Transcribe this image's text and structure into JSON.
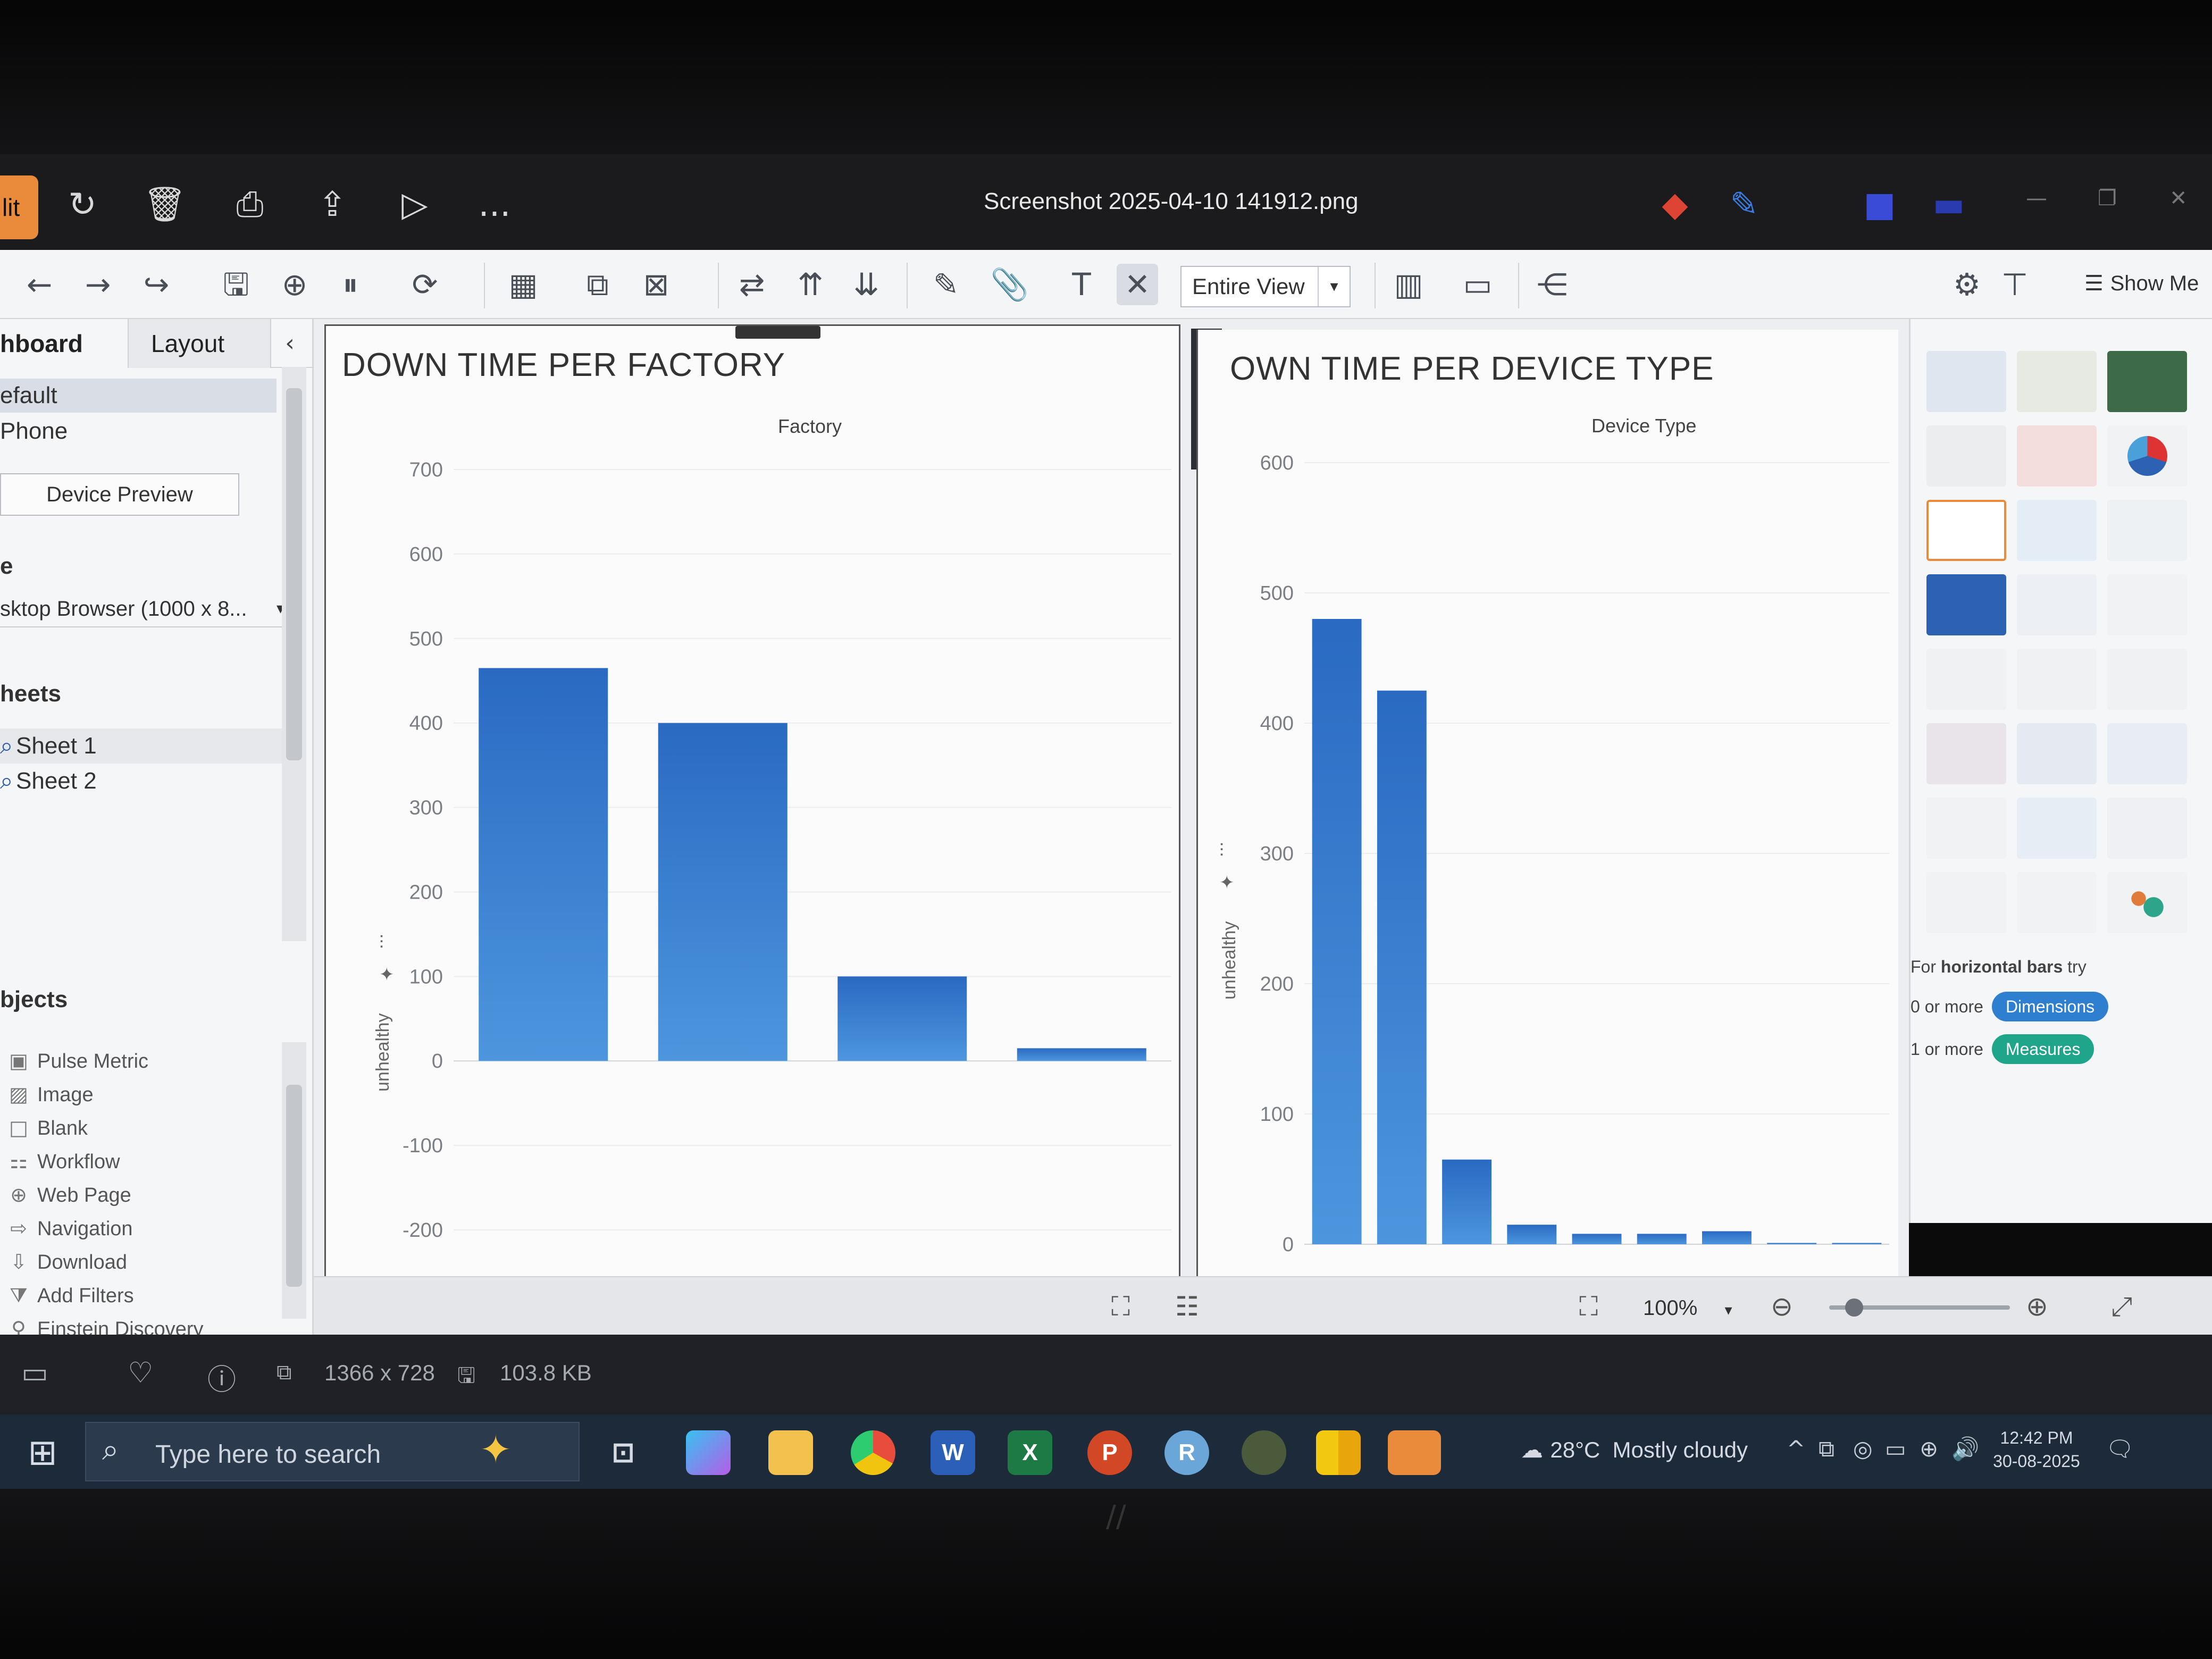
{
  "photos_app": {
    "edit_label": "lit",
    "file_title": "Screenshot 2025-04-10 141912.png",
    "more_label": "...",
    "info": {
      "dimensions": "1366 x 728",
      "file_size": "103.8 KB"
    }
  },
  "toolbar": {
    "fit_select": "Entire View",
    "show_me_label": "Show Me"
  },
  "left_pane": {
    "tabs": {
      "dashboard": "hboard",
      "layout": "Layout"
    },
    "device_items": [
      "efault",
      "Phone"
    ],
    "device_preview_label": "Device Preview",
    "size_section": "e",
    "size_value": "sktop Browser (1000 x 8...",
    "sheets_header": "heets",
    "sheets": [
      "Sheet 1",
      "Sheet 2"
    ],
    "objects_header": "bjects",
    "objects": [
      "Pulse Metric",
      "Image",
      "Blank",
      "Workflow",
      "Web Page",
      "Navigation",
      "Download",
      "Add Filters",
      "Einstein Discovery"
    ]
  },
  "chart_data": [
    {
      "type": "bar",
      "title": "DOWN TIME PER FACTORY",
      "xlabel": "Factory",
      "ylabel": "unhealthy",
      "ylim": [
        -200,
        700
      ],
      "ticks": [
        "700",
        "600",
        "500",
        "400",
        "300",
        "200",
        "100",
        "0",
        "-100",
        "-200"
      ],
      "values": [
        465,
        400,
        100,
        15
      ]
    },
    {
      "type": "bar",
      "title": "OWN TIME PER DEVICE TYPE",
      "xlabel": "Device Type",
      "ylabel": "unhealthy",
      "ylim": [
        0,
        600
      ],
      "ticks": [
        "600",
        "500",
        "400",
        "300",
        "200",
        "100",
        "0"
      ],
      "values": [
        480,
        425,
        65,
        15,
        8,
        8,
        10,
        1,
        1
      ]
    }
  ],
  "show_me": {
    "hint_prefix": "For ",
    "hint_bold": "horizontal bars",
    "hint_suffix": " try",
    "row1_prefix": "0 or more",
    "row1_pill": "Dimensions",
    "row2_prefix": "1 or more",
    "row2_pill": "Measures"
  },
  "status": {
    "zoom": "100%"
  },
  "taskbar": {
    "search_placeholder": "Type here to search",
    "weather_temp": "28°C",
    "weather_text": "Mostly cloudy",
    "time": "12:42 PM",
    "date": "30-08-2025"
  },
  "colors": {
    "bar": "#2d6fc4",
    "dimensions_pill": "#2f7fd0",
    "measures_pill": "#1fa68a",
    "edit_button": "#e98b3b"
  }
}
